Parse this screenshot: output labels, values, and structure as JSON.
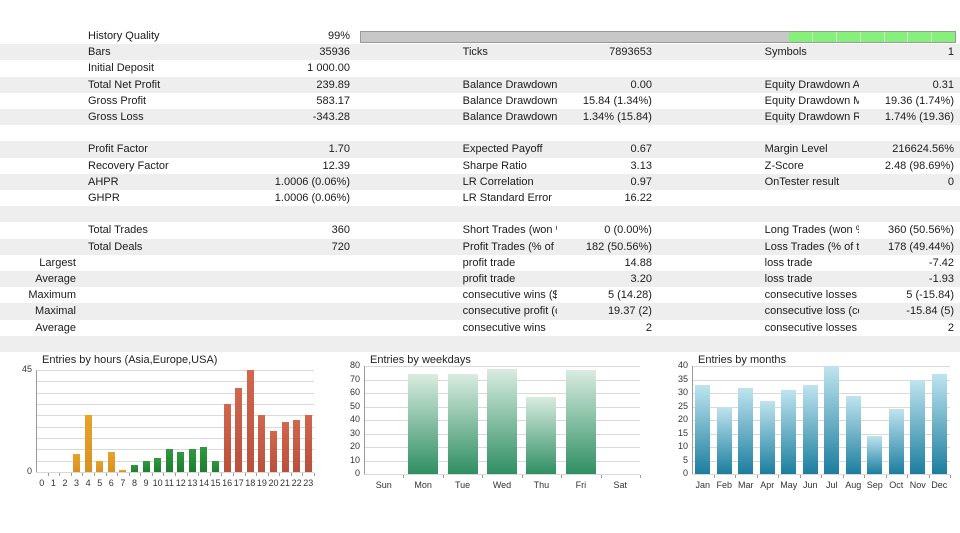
{
  "history_quality": {
    "label": "History Quality",
    "value": "99%",
    "fill_percent": 28,
    "bar_color": "#87ef7b",
    "track_color": "#c8c8c8"
  },
  "rows": [
    {
      "pre": "",
      "label": "History Quality",
      "value": "99%",
      "pre2": "",
      "label2": "",
      "value2": "",
      "pre3": "",
      "label3": "",
      "value3": "",
      "bar": true
    },
    {
      "pre": "",
      "label": "Bars",
      "value": "35936",
      "pre2": "",
      "label2": "Ticks",
      "value2": "7893653",
      "pre3": "",
      "label3": "Symbols",
      "value3": "1"
    },
    {
      "pre": "",
      "label": "Initial Deposit",
      "value": "1 000.00",
      "pre2": "",
      "label2": "",
      "value2": "",
      "pre3": "",
      "label3": "",
      "value3": ""
    },
    {
      "pre": "",
      "label": "Total Net Profit",
      "value": "239.89",
      "pre2": "",
      "label2": "Balance Drawdown Absolute",
      "value2": "0.00",
      "pre3": "",
      "label3": "Equity Drawdown Absolute",
      "value3": "0.31"
    },
    {
      "pre": "",
      "label": "Gross Profit",
      "value": "583.17",
      "pre2": "",
      "label2": "Balance Drawdown Maximal",
      "value2": "15.84 (1.34%)",
      "pre3": "",
      "label3": "Equity Drawdown Maximal",
      "value3": "19.36 (1.74%)"
    },
    {
      "pre": "",
      "label": "Gross Loss",
      "value": "-343.28",
      "pre2": "",
      "label2": "Balance Drawdown Relative",
      "value2": "1.34% (15.84)",
      "pre3": "",
      "label3": "Equity Drawdown Relative",
      "value3": "1.74% (19.36)"
    },
    {
      "pre": "",
      "label": "",
      "value": "",
      "pre2": "",
      "label2": "",
      "value2": "",
      "pre3": "",
      "label3": "",
      "value3": ""
    },
    {
      "pre": "",
      "label": "Profit Factor",
      "value": "1.70",
      "pre2": "",
      "label2": "Expected Payoff",
      "value2": "0.67",
      "pre3": "",
      "label3": "Margin Level",
      "value3": "216624.56%"
    },
    {
      "pre": "",
      "label": "Recovery Factor",
      "value": "12.39",
      "pre2": "",
      "label2": "Sharpe Ratio",
      "value2": "3.13",
      "pre3": "",
      "label3": "Z-Score",
      "value3": "2.48 (98.69%)"
    },
    {
      "pre": "",
      "label": "AHPR",
      "value": "1.0006 (0.06%)",
      "pre2": "",
      "label2": "LR Correlation",
      "value2": "0.97",
      "pre3": "",
      "label3": "OnTester result",
      "value3": "0"
    },
    {
      "pre": "",
      "label": "GHPR",
      "value": "1.0006 (0.06%)",
      "pre2": "",
      "label2": "LR Standard Error",
      "value2": "16.22",
      "pre3": "",
      "label3": "",
      "value3": ""
    },
    {
      "pre": "",
      "label": "",
      "value": "",
      "pre2": "",
      "label2": "",
      "value2": "",
      "pre3": "",
      "label3": "",
      "value3": ""
    },
    {
      "pre": "",
      "label": "Total Trades",
      "value": "360",
      "pre2": "",
      "label2": "Short Trades (won %)",
      "value2": "0 (0.00%)",
      "pre3": "",
      "label3": "Long Trades (won %)",
      "value3": "360 (50.56%)"
    },
    {
      "pre": "",
      "label": "Total Deals",
      "value": "720",
      "pre2": "",
      "label2": "Profit Trades (% of total)",
      "value2": "182 (50.56%)",
      "pre3": "",
      "label3": "Loss Trades (% of total)",
      "value3": "178 (49.44%)"
    },
    {
      "pre": "Largest",
      "label": "",
      "value": "",
      "pre2": "",
      "label2": "profit trade",
      "value2": "14.88",
      "pre3": "",
      "label3": "loss trade",
      "value3": "-7.42"
    },
    {
      "pre": "Average",
      "label": "",
      "value": "",
      "pre2": "",
      "label2": "profit trade",
      "value2": "3.20",
      "pre3": "",
      "label3": "loss trade",
      "value3": "-1.93"
    },
    {
      "pre": "Maximum",
      "label": "",
      "value": "",
      "pre2": "",
      "label2": "consecutive wins ($)",
      "value2": "5 (14.28)",
      "pre3": "",
      "label3": "consecutive losses ($)",
      "value3": "5 (-15.84)"
    },
    {
      "pre": "Maximal",
      "label": "",
      "value": "",
      "pre2": "",
      "label2": "consecutive profit (count)",
      "value2": "19.37 (2)",
      "pre3": "",
      "label3": "consecutive loss (count)",
      "value3": "-15.84 (5)"
    },
    {
      "pre": "Average",
      "label": "",
      "value": "",
      "pre2": "",
      "label2": "consecutive wins",
      "value2": "2",
      "pre3": "",
      "label3": "consecutive losses",
      "value3": "2"
    },
    {
      "pre": "",
      "label": "",
      "value": "",
      "pre2": "",
      "label2": "",
      "value2": "",
      "pre3": "",
      "label3": "",
      "value3": ""
    }
  ],
  "chart_data": [
    {
      "type": "bar",
      "id": "hours",
      "title": "Entries by hours (Asia,Europe,USA)",
      "xlabel": "",
      "ylabel": "",
      "ylim": [
        0,
        45
      ],
      "yticks": [
        0,
        45
      ],
      "gridlines": [
        0,
        5,
        10,
        15,
        20,
        25,
        30,
        35,
        40,
        45
      ],
      "grid": true,
      "legend": "none",
      "categories": [
        "0",
        "1",
        "2",
        "3",
        "4",
        "5",
        "6",
        "7",
        "8",
        "9",
        "10",
        "11",
        "12",
        "13",
        "14",
        "15",
        "16",
        "17",
        "18",
        "19",
        "20",
        "21",
        "22",
        "23"
      ],
      "values": [
        0,
        0,
        0,
        8,
        25,
        5,
        9,
        1,
        3,
        5,
        6,
        10,
        9,
        10,
        11,
        5,
        30,
        37,
        45,
        25,
        18,
        22,
        23,
        25
      ],
      "session_groups": [
        {
          "name": "Asia",
          "color": "#e0991f",
          "from": 0,
          "to": 7
        },
        {
          "name": "Europe",
          "color": "#2b8e3a",
          "from": 8,
          "to": 15
        },
        {
          "name": "USA",
          "color": "#c85c45",
          "from": 16,
          "to": 23
        }
      ]
    },
    {
      "type": "bar",
      "id": "weekdays",
      "title": "Entries by weekdays",
      "xlabel": "",
      "ylabel": "",
      "ylim": [
        0,
        80
      ],
      "yticks": [
        0,
        10,
        20,
        30,
        40,
        50,
        60,
        70,
        80
      ],
      "grid": true,
      "legend": "none",
      "color": "#2f8f63",
      "categories": [
        "Sun",
        "Mon",
        "Tue",
        "Wed",
        "Thu",
        "Fri",
        "Sat"
      ],
      "values": [
        0,
        74,
        74,
        78,
        57,
        77,
        0
      ]
    },
    {
      "type": "bar",
      "id": "months",
      "title": "Entries by months",
      "xlabel": "",
      "ylabel": "",
      "ylim": [
        0,
        40
      ],
      "yticks": [
        0,
        5,
        10,
        15,
        20,
        25,
        30,
        35,
        40
      ],
      "grid": true,
      "legend": "none",
      "color": "#1b7e9e",
      "categories": [
        "Jan",
        "Feb",
        "Mar",
        "Apr",
        "May",
        "Jun",
        "Jul",
        "Aug",
        "Sep",
        "Oct",
        "Nov",
        "Dec"
      ],
      "values": [
        33,
        25,
        32,
        27,
        31,
        33,
        40,
        29,
        14,
        24,
        35,
        37
      ]
    }
  ]
}
